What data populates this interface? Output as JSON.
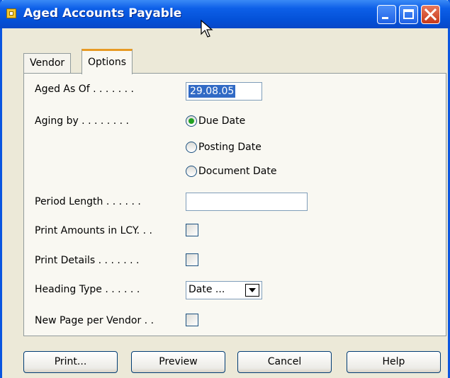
{
  "window": {
    "title": "Aged Accounts Payable"
  },
  "tabs": [
    {
      "label": "Vendor",
      "active": false
    },
    {
      "label": "Options",
      "active": true
    }
  ],
  "options": {
    "aged_as_of": {
      "label": "Aged As Of . . . . . . .",
      "value": "29.08.05"
    },
    "aging_by": {
      "label": "Aging by . . . . . . . .",
      "choices": [
        "Due Date",
        "Posting Date",
        "Document Date"
      ],
      "selected": "Due Date"
    },
    "period_length": {
      "label": "Period Length . . . . . .",
      "value": ""
    },
    "print_amounts_lcy": {
      "label": "Print Amounts in LCY. . .",
      "checked": false
    },
    "print_details": {
      "label": "Print Details . . . . . . .",
      "checked": false
    },
    "heading_type": {
      "label": "Heading Type . . . . . .",
      "value": "Date ..."
    },
    "new_page_per_vendor": {
      "label": "New Page per Vendor . .",
      "checked": false
    }
  },
  "buttons": {
    "print": "Print...",
    "preview": "Preview",
    "cancel": "Cancel",
    "help": "Help"
  },
  "colors": {
    "titlebar": "#0451d8",
    "dialog_bg": "#ece9d8",
    "active_tab_accent": "#e79a24",
    "selection": "#316ac5",
    "radio_dot": "#21a121"
  }
}
